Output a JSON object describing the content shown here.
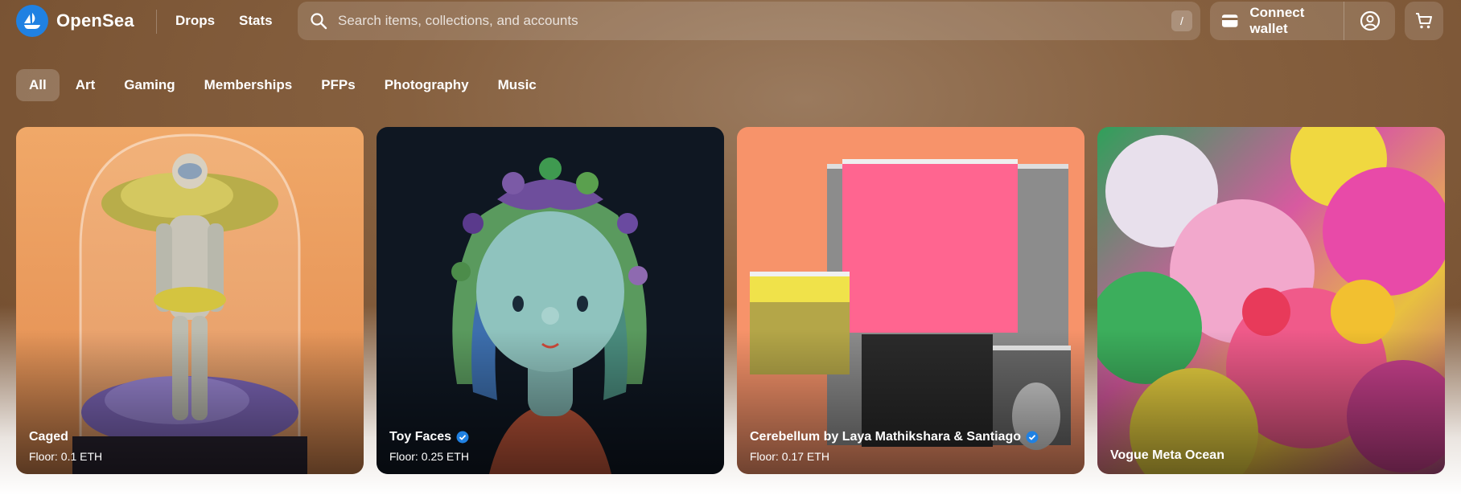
{
  "app": {
    "name": "OpenSea",
    "brand_color": "#2081e2"
  },
  "nav": {
    "drops": "Drops",
    "stats": "Stats"
  },
  "search": {
    "placeholder": "Search items, collections, and accounts",
    "shortcut": "/"
  },
  "wallet": {
    "connect_label": "Connect wallet"
  },
  "categories": [
    {
      "label": "All",
      "active": true
    },
    {
      "label": "Art"
    },
    {
      "label": "Gaming"
    },
    {
      "label": "Memberships"
    },
    {
      "label": "PFPs"
    },
    {
      "label": "Photography"
    },
    {
      "label": "Music"
    }
  ],
  "cards": [
    {
      "title": "Caged",
      "floor_label": "Floor:",
      "floor_value": "0.1 ETH",
      "verified": false
    },
    {
      "title": "Toy Faces",
      "floor_label": "Floor:",
      "floor_value": "0.25 ETH",
      "verified": true
    },
    {
      "title": "Cerebellum by Laya Mathikshara & Santiago",
      "floor_label": "Floor:",
      "floor_value": "0.17 ETH",
      "verified": true
    },
    {
      "title": "Vogue Meta Ocean",
      "verified": false
    }
  ]
}
